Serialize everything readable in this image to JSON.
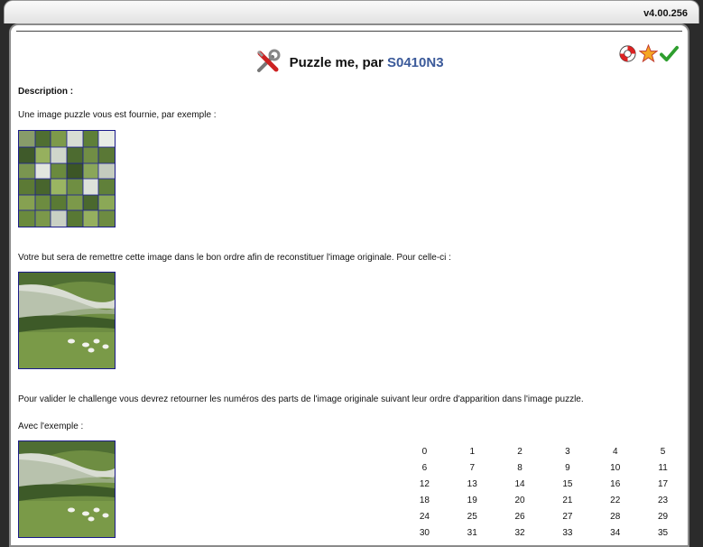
{
  "app": {
    "version": "v4.00.256"
  },
  "header": {
    "title_prefix": "Puzzle me, par",
    "author": "S0410N3"
  },
  "icons": {
    "title": "tools-icon",
    "help": "lifebuoy-icon",
    "favorite": "star-icon",
    "validate": "checkmark-icon"
  },
  "content": {
    "description_label": "Description :",
    "intro": "Une image puzzle vous est fournie, par exemple :",
    "goal": "Votre but sera de remettre cette image dans le bon ordre afin de reconstituer l'image originale. Pour celle-ci :",
    "validation": "Pour valider le challenge vous devrez retourner les numéros des parts de l'image originale suivant leur ordre d'apparition dans l'image puzzle.",
    "example_label": "Avec l'exemple :"
  },
  "grid_numbers": [
    "0",
    "1",
    "2",
    "3",
    "4",
    "5",
    "6",
    "7",
    "8",
    "9",
    "10",
    "11",
    "12",
    "13",
    "14",
    "15",
    "16",
    "17",
    "18",
    "19",
    "20",
    "21",
    "22",
    "23",
    "24",
    "25",
    "26",
    "27",
    "28",
    "29",
    "30",
    "31",
    "32",
    "33",
    "34",
    "35"
  ],
  "colors": {
    "author": "#3b5a9a",
    "frame": "#2b2b2b"
  }
}
